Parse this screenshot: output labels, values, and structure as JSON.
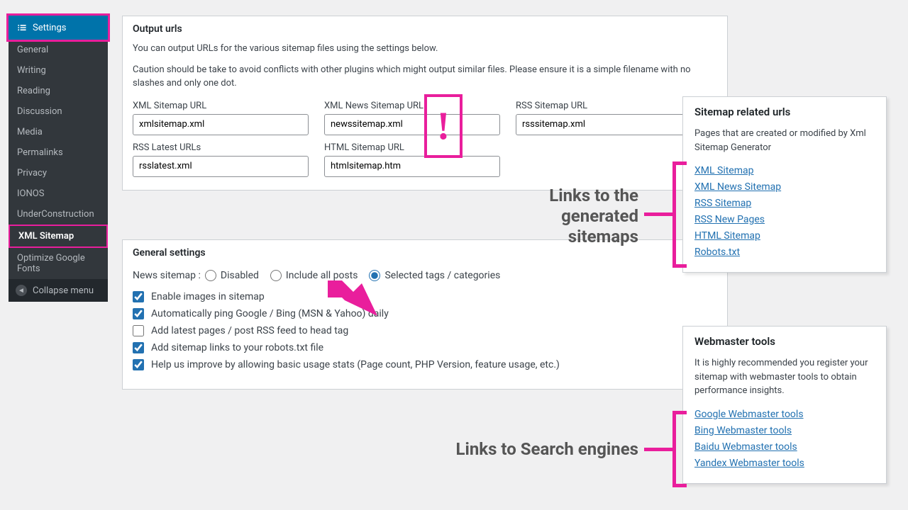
{
  "colors": {
    "highlight": "#e91e9c",
    "link": "#2271b1",
    "wp_blue": "#0073aa"
  },
  "sidebar": {
    "settings_label": "Settings",
    "items": [
      {
        "label": "General"
      },
      {
        "label": "Writing"
      },
      {
        "label": "Reading"
      },
      {
        "label": "Discussion"
      },
      {
        "label": "Media"
      },
      {
        "label": "Permalinks"
      },
      {
        "label": "Privacy"
      },
      {
        "label": "IONOS"
      },
      {
        "label": "UnderConstruction"
      },
      {
        "label": "XML Sitemap",
        "active": true
      },
      {
        "label": "Optimize Google Fonts"
      }
    ],
    "collapse_label": "Collapse menu"
  },
  "output_panel": {
    "title": "Output urls",
    "intro": "You can output URLs for the various sitemap files using the settings below.",
    "caution": "Caution should be take to avoid conflicts with other plugins which might output similar files. Please ensure it is a simple filename with no slashes and only one dot.",
    "fields": {
      "xml_label": "XML Sitemap URL",
      "xml_value": "xmlsitemap.xml",
      "news_label": "XML News Sitemap URL",
      "news_value": "newssitemap.xml",
      "rss_label": "RSS Sitemap URL",
      "rss_value": "rsssitemap.xml",
      "rsslatest_label": "RSS Latest URLs",
      "rsslatest_value": "rsslatest.xml",
      "html_label": "HTML Sitemap URL",
      "html_value": "htmlsitemap.htm"
    }
  },
  "general_panel": {
    "title": "General settings",
    "news_label": "News sitemap :",
    "radios": {
      "disabled": "Disabled",
      "include_all": "Include all posts",
      "selected": "Selected tags / categories"
    },
    "radio_selected": "selected",
    "checks": {
      "images": {
        "label": "Enable images in sitemap",
        "checked": true
      },
      "ping": {
        "label": "Automatically ping Google / Bing (MSN & Yahoo) daily",
        "checked": true
      },
      "rss_head": {
        "label": "Add latest pages / post RSS feed to head tag",
        "checked": false
      },
      "robots": {
        "label": "Add sitemap links to your robots.txt file",
        "checked": true
      },
      "stats": {
        "label": "Help us improve by allowing basic usage stats (Page count, PHP Version, feature usage, etc.)",
        "checked": true
      }
    }
  },
  "sitemap_panel": {
    "title": "Sitemap related urls",
    "desc": "Pages that are created or modified by Xml Sitemap Generator",
    "links": {
      "xml": "XML Sitemap",
      "news": "XML News Sitemap",
      "rss": "RSS Sitemap",
      "rssnew": "RSS New Pages",
      "html": "HTML Sitemap",
      "robots": "Robots.txt"
    }
  },
  "webmaster_panel": {
    "title": "Webmaster tools",
    "desc": "It is highly recommended you register your sitemap with webmaster tools to obtain performance insights.",
    "links": {
      "google": "Google Webmaster tools",
      "bing": "Bing Webmaster tools",
      "baidu": "Baidu Webmaster tools",
      "yandex": "Yandex Webmaster tools"
    }
  },
  "annotations": {
    "exclaim": "!",
    "sitemap_links": "Links to the generated sitemaps",
    "search_engines": "Links to Search engines"
  }
}
